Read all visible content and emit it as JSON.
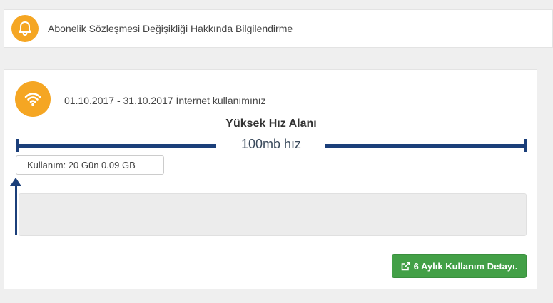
{
  "notice": {
    "icon": "bell-icon",
    "text": "Abonelik Sözleşmesi Değişikliği Hakkında Bilgilendirme"
  },
  "usage": {
    "icon": "wifi-icon",
    "period_text": "01.10.2017 - 31.10.2017 İnternet kullanımınız",
    "zone_title": "Yüksek Hız Alanı",
    "speed_text": "100mb hız",
    "usage_label": "Kullanım: 20 Gün 0.09 GB",
    "detail_button": {
      "icon": "external-link-icon",
      "label": "6 Aylık Kullanım Detayı."
    }
  },
  "colors": {
    "accent_orange": "#f5a623",
    "bar_navy": "#1b3f7a",
    "button_green": "#43a047"
  }
}
